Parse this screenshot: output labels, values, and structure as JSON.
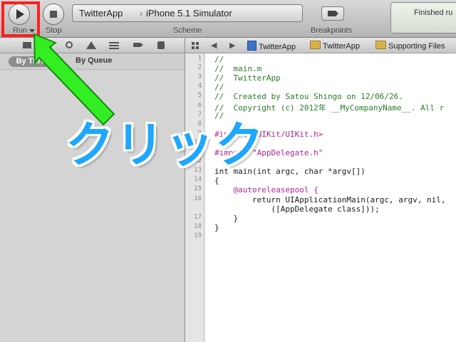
{
  "toolbar": {
    "run_label": "Run",
    "stop_label": "Stop",
    "scheme_label": "Scheme",
    "scheme": {
      "target": "TwitterApp",
      "destination": "iPhone 5.1 Simulator"
    },
    "breakpoints_label": "Breakpoints",
    "status_text": "Finished ru"
  },
  "navigator": {
    "segments": {
      "selected": "By Thread",
      "other": "By Queue"
    }
  },
  "jumpbar": {
    "items": [
      "TwitterApp",
      "TwitterApp",
      "Supporting Files"
    ]
  },
  "editor": {
    "line_numbers": [
      "1",
      "2",
      "3",
      "4",
      "5",
      "6",
      "7",
      "8",
      "9",
      "10",
      "11",
      "12",
      "13",
      "14",
      "15",
      "16",
      "",
      "17",
      "18",
      "19"
    ],
    "lines": [
      "//",
      "//  main.m",
      "//  TwitterApp",
      "//",
      "//  Created by Satou Shingo on 12/06/26.",
      "//  Copyright (c) 2012年 __MyCompanyName__. All r",
      "//",
      "",
      "#import <UIKit/UIKit.h>",
      "",
      "#import \"AppDelegate.h\"",
      "",
      "int main(int argc, char *argv[])",
      "{",
      "    @autoreleasepool {",
      "        return UIApplicationMain(argc, argv, nil,",
      "            ([AppDelegate class]));",
      "    }",
      "}",
      ""
    ]
  },
  "overlay": {
    "click_text": "クリック",
    "accent_arrow": "#33ee22",
    "accent_highlight": "#ff1f1f",
    "accent_text": "#1ea7ff"
  }
}
